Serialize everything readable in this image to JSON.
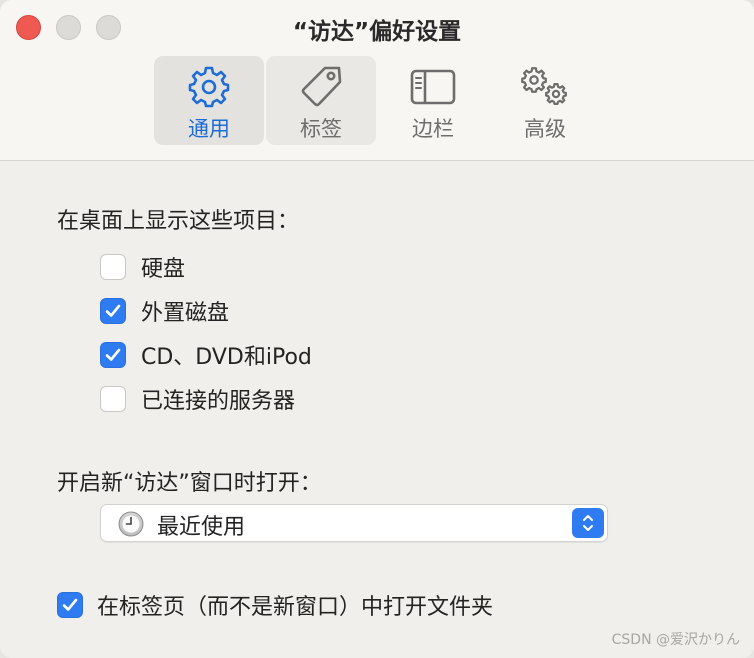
{
  "window": {
    "title": "“访达”偏好设置"
  },
  "toolbar": {
    "tabs": [
      {
        "label": "通用",
        "icon": "gear-icon",
        "state": "selected"
      },
      {
        "label": "标签",
        "icon": "tag-icon",
        "state": "hovered"
      },
      {
        "label": "边栏",
        "icon": "sidebar-icon",
        "state": "normal"
      },
      {
        "label": "高级",
        "icon": "gears-icon",
        "state": "normal"
      }
    ]
  },
  "desktop_section": {
    "label": "在桌面上显示这些项目：",
    "items": [
      {
        "label": "硬盘",
        "checked": false
      },
      {
        "label": "外置磁盘",
        "checked": true
      },
      {
        "label": "CD、DVD和iPod",
        "checked": true
      },
      {
        "label": "已连接的服务器",
        "checked": false
      }
    ]
  },
  "new_window_section": {
    "label": "开启新“访达”窗口时打开：",
    "selected": "最近使用",
    "icon": "clock-icon"
  },
  "tabs_option": {
    "label": "在标签页（而不是新窗口）中打开文件夹",
    "checked": true
  },
  "watermark": "CSDN @爱沢かりん",
  "colors": {
    "accent": "#2f7bf2",
    "selected_tab_text": "#1e6cd6",
    "close_button": "#ee5a52"
  }
}
